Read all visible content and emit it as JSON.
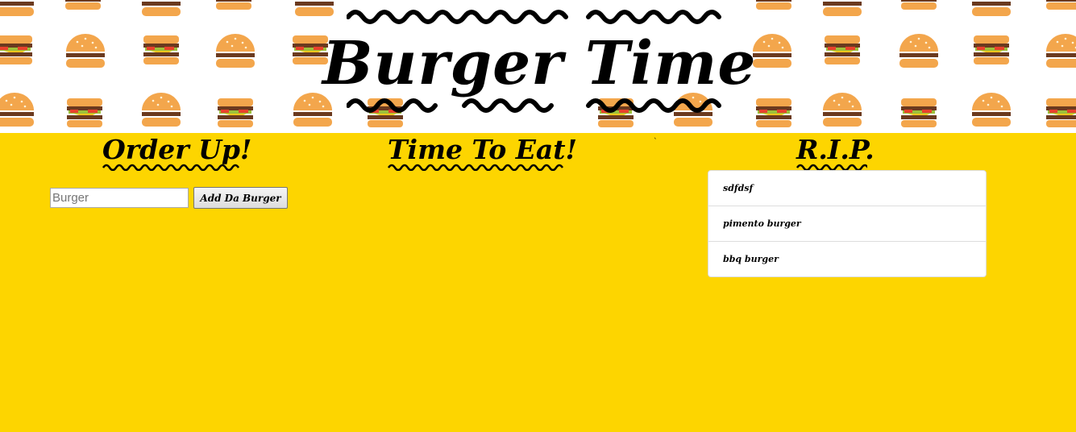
{
  "header": {
    "title": "Burger Time"
  },
  "columns": {
    "order_up": {
      "heading": "Order Up!",
      "input_placeholder": "Burger",
      "add_button_label": "Add Da Burger"
    },
    "time_to_eat": {
      "heading": "Time To Eat!"
    },
    "rip": {
      "heading": "R.I.P.",
      "items": [
        "sdfdsf",
        "pimento burger",
        "bbq burger"
      ]
    }
  },
  "colors": {
    "background": "#fdd500",
    "header_background": "#ffffff",
    "text": "#000000",
    "bun": "#f0a64a",
    "patty": "#6b3a1f",
    "lettuce": "#9dc13a",
    "tomato": "#e8412c",
    "cheese": "#f7c51c"
  }
}
